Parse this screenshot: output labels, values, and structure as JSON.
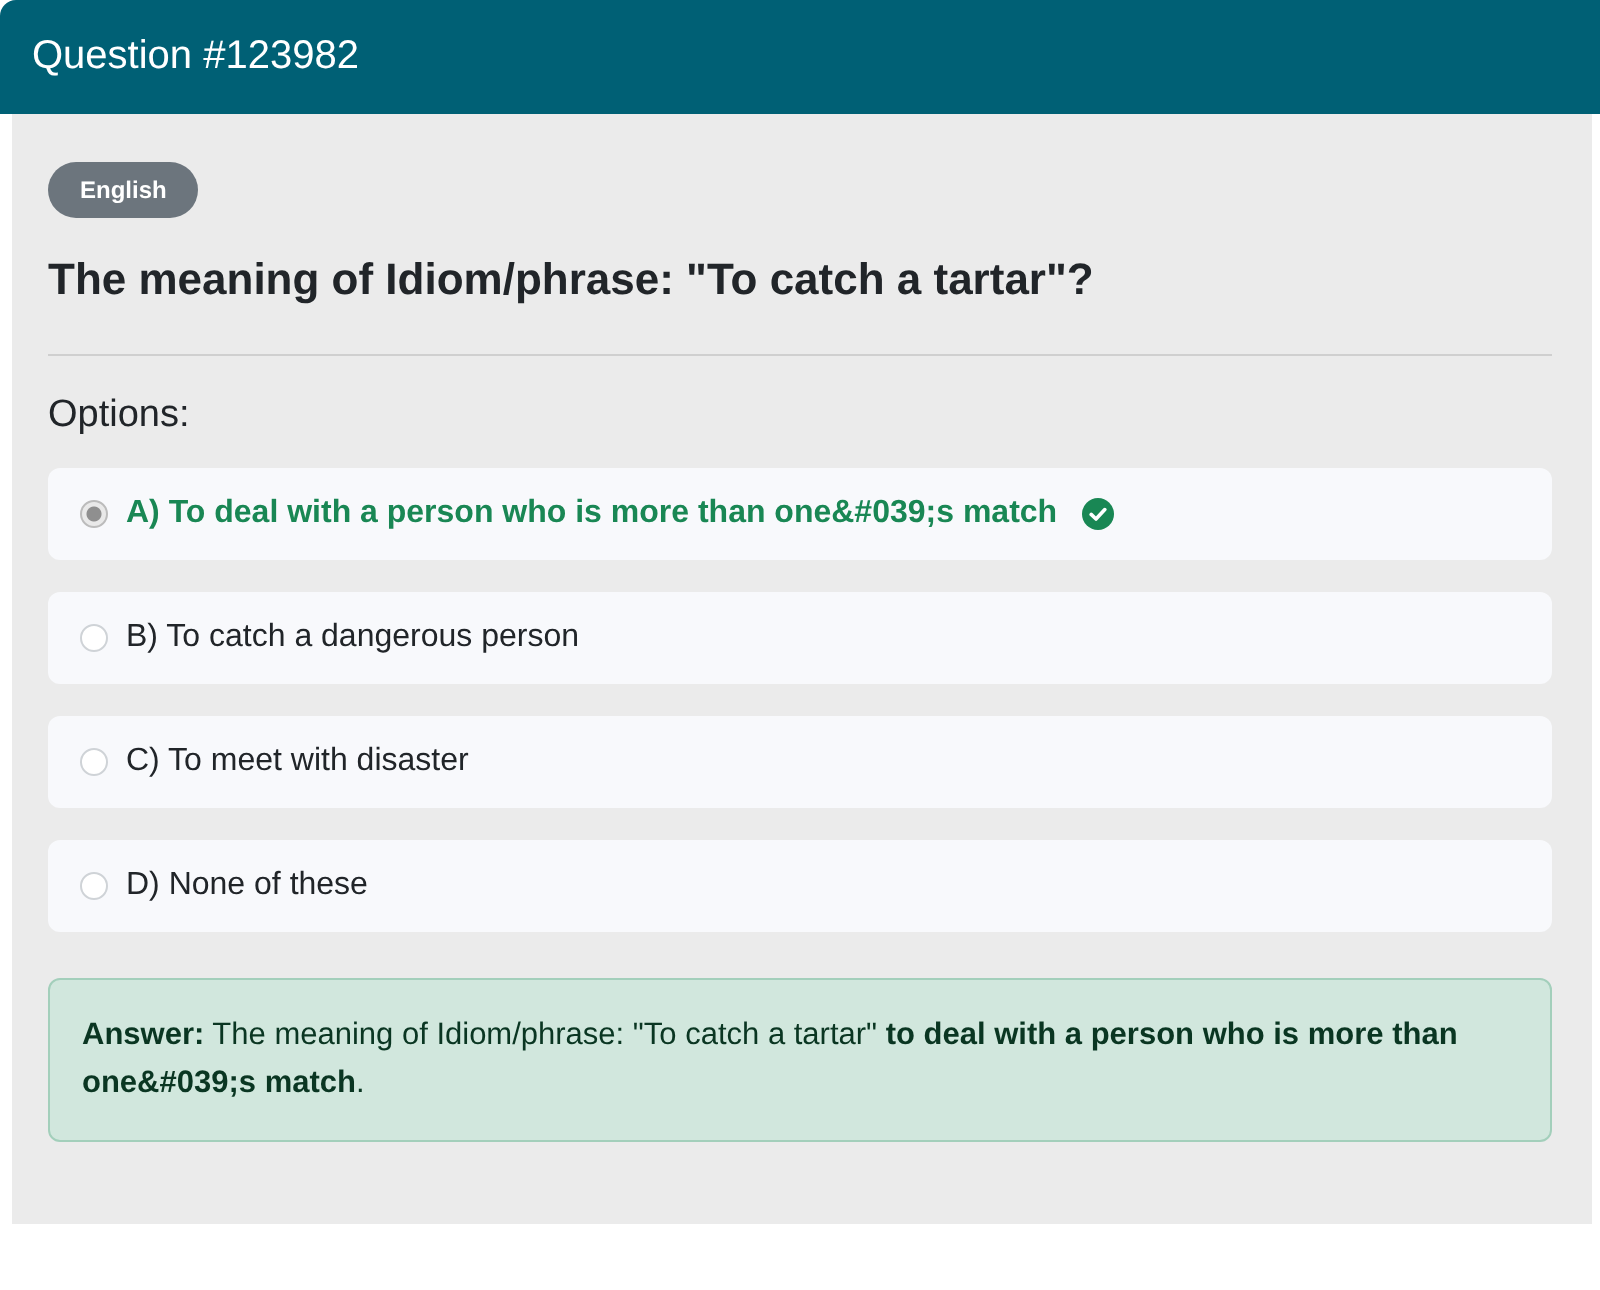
{
  "header": {
    "title": "Question #123982"
  },
  "badge": "English",
  "question": "The meaning of Idiom/phrase: \"To catch a tartar\"?",
  "options_label": "Options:",
  "options": [
    {
      "label": "A) To deal with a person who is more than one&#039;s match",
      "selected": true,
      "correct": true
    },
    {
      "label": "B) To catch a dangerous person",
      "selected": false,
      "correct": false
    },
    {
      "label": "C) To meet with disaster",
      "selected": false,
      "correct": false
    },
    {
      "label": "D) None of these",
      "selected": false,
      "correct": false
    }
  ],
  "answer": "**Answer:** The meaning of Idiom/phrase: \"To catch a tartar\" **to deal with a person who is more than one&#039;s match**."
}
